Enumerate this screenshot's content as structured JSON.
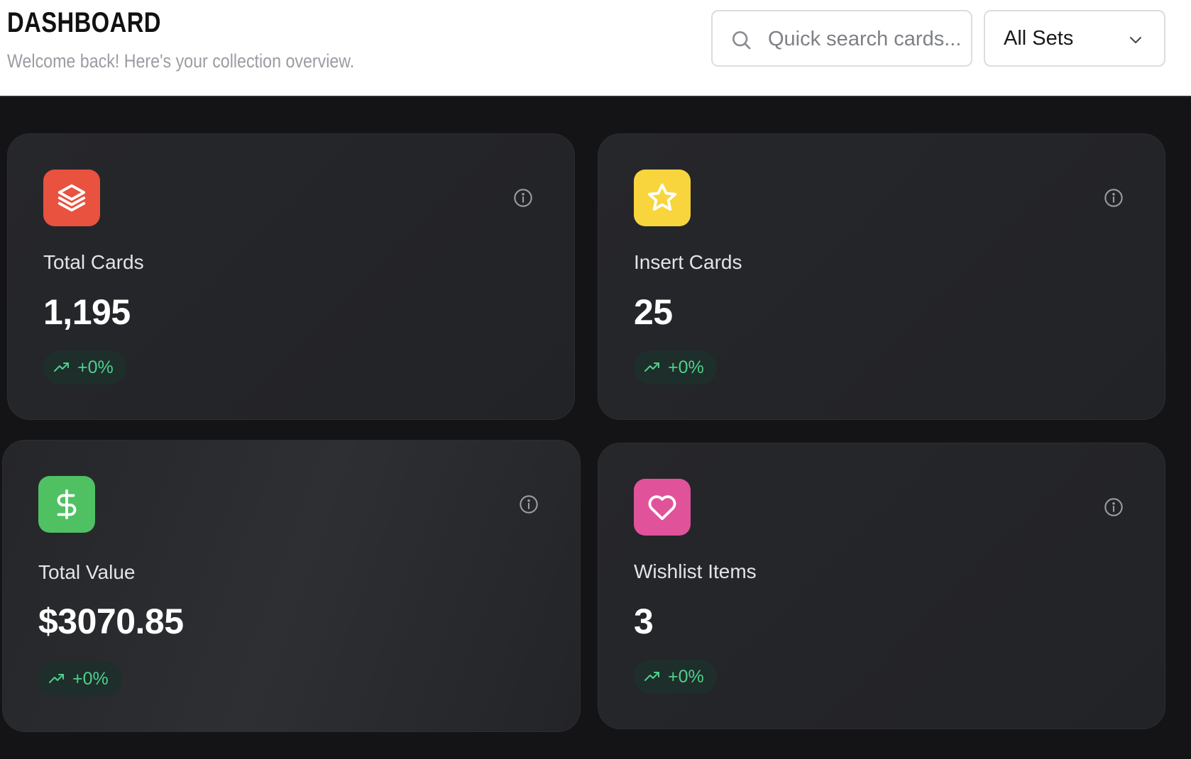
{
  "header": {
    "title": "DASHBOARD",
    "subtitle": "Welcome back! Here's your collection overview."
  },
  "search": {
    "placeholder": "Quick search cards...",
    "value": ""
  },
  "set_filter": {
    "selected": "All Sets"
  },
  "icons": {
    "search": "search-icon",
    "chevron": "chevron-down-icon",
    "info": "info-icon",
    "trend": "trending-up-icon"
  },
  "colors": {
    "total_cards_accent": "#e8523f",
    "insert_cards_accent": "#f8d53c",
    "total_value_accent": "#4fc163",
    "wishlist_accent": "#e0529a",
    "trend_positive": "#4fd08e"
  },
  "stats": [
    {
      "label": "Total Cards",
      "value": "1,195",
      "trend": "+0%",
      "icon": "layers-icon"
    },
    {
      "label": "Insert Cards",
      "value": "25",
      "trend": "+0%",
      "icon": "star-icon"
    },
    {
      "label": "Total Value",
      "value": "$3070.85",
      "trend": "+0%",
      "icon": "dollar-icon"
    },
    {
      "label": "Wishlist Items",
      "value": "3",
      "trend": "+0%",
      "icon": "heart-icon"
    }
  ]
}
